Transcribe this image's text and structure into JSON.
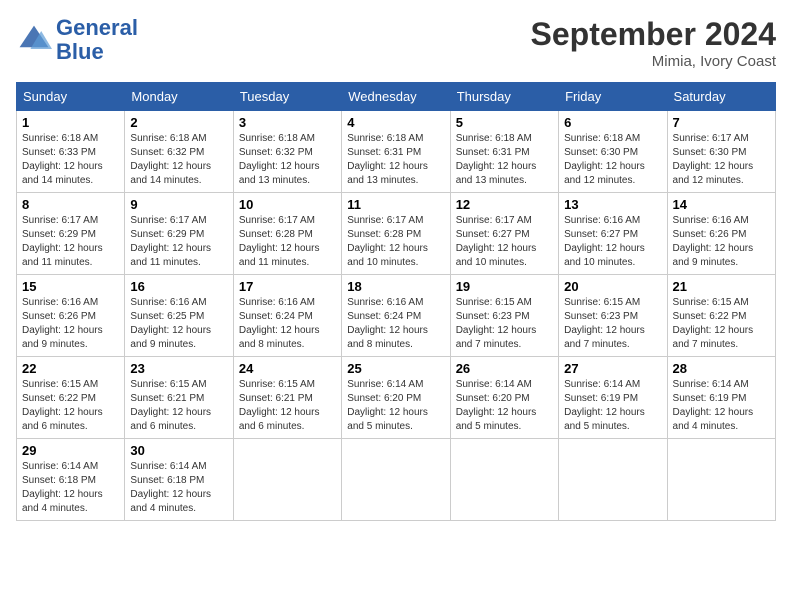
{
  "header": {
    "logo_line1": "General",
    "logo_line2": "Blue",
    "month_title": "September 2024",
    "location": "Mimia, Ivory Coast"
  },
  "days_of_week": [
    "Sunday",
    "Monday",
    "Tuesday",
    "Wednesday",
    "Thursday",
    "Friday",
    "Saturday"
  ],
  "weeks": [
    [
      {
        "num": "1",
        "sunrise": "6:18 AM",
        "sunset": "6:33 PM",
        "daylight": "12 hours and 14 minutes."
      },
      {
        "num": "2",
        "sunrise": "6:18 AM",
        "sunset": "6:32 PM",
        "daylight": "12 hours and 14 minutes."
      },
      {
        "num": "3",
        "sunrise": "6:18 AM",
        "sunset": "6:32 PM",
        "daylight": "12 hours and 13 minutes."
      },
      {
        "num": "4",
        "sunrise": "6:18 AM",
        "sunset": "6:31 PM",
        "daylight": "12 hours and 13 minutes."
      },
      {
        "num": "5",
        "sunrise": "6:18 AM",
        "sunset": "6:31 PM",
        "daylight": "12 hours and 13 minutes."
      },
      {
        "num": "6",
        "sunrise": "6:18 AM",
        "sunset": "6:30 PM",
        "daylight": "12 hours and 12 minutes."
      },
      {
        "num": "7",
        "sunrise": "6:17 AM",
        "sunset": "6:30 PM",
        "daylight": "12 hours and 12 minutes."
      }
    ],
    [
      {
        "num": "8",
        "sunrise": "6:17 AM",
        "sunset": "6:29 PM",
        "daylight": "12 hours and 11 minutes."
      },
      {
        "num": "9",
        "sunrise": "6:17 AM",
        "sunset": "6:29 PM",
        "daylight": "12 hours and 11 minutes."
      },
      {
        "num": "10",
        "sunrise": "6:17 AM",
        "sunset": "6:28 PM",
        "daylight": "12 hours and 11 minutes."
      },
      {
        "num": "11",
        "sunrise": "6:17 AM",
        "sunset": "6:28 PM",
        "daylight": "12 hours and 10 minutes."
      },
      {
        "num": "12",
        "sunrise": "6:17 AM",
        "sunset": "6:27 PM",
        "daylight": "12 hours and 10 minutes."
      },
      {
        "num": "13",
        "sunrise": "6:16 AM",
        "sunset": "6:27 PM",
        "daylight": "12 hours and 10 minutes."
      },
      {
        "num": "14",
        "sunrise": "6:16 AM",
        "sunset": "6:26 PM",
        "daylight": "12 hours and 9 minutes."
      }
    ],
    [
      {
        "num": "15",
        "sunrise": "6:16 AM",
        "sunset": "6:26 PM",
        "daylight": "12 hours and 9 minutes."
      },
      {
        "num": "16",
        "sunrise": "6:16 AM",
        "sunset": "6:25 PM",
        "daylight": "12 hours and 9 minutes."
      },
      {
        "num": "17",
        "sunrise": "6:16 AM",
        "sunset": "6:24 PM",
        "daylight": "12 hours and 8 minutes."
      },
      {
        "num": "18",
        "sunrise": "6:16 AM",
        "sunset": "6:24 PM",
        "daylight": "12 hours and 8 minutes."
      },
      {
        "num": "19",
        "sunrise": "6:15 AM",
        "sunset": "6:23 PM",
        "daylight": "12 hours and 7 minutes."
      },
      {
        "num": "20",
        "sunrise": "6:15 AM",
        "sunset": "6:23 PM",
        "daylight": "12 hours and 7 minutes."
      },
      {
        "num": "21",
        "sunrise": "6:15 AM",
        "sunset": "6:22 PM",
        "daylight": "12 hours and 7 minutes."
      }
    ],
    [
      {
        "num": "22",
        "sunrise": "6:15 AM",
        "sunset": "6:22 PM",
        "daylight": "12 hours and 6 minutes."
      },
      {
        "num": "23",
        "sunrise": "6:15 AM",
        "sunset": "6:21 PM",
        "daylight": "12 hours and 6 minutes."
      },
      {
        "num": "24",
        "sunrise": "6:15 AM",
        "sunset": "6:21 PM",
        "daylight": "12 hours and 6 minutes."
      },
      {
        "num": "25",
        "sunrise": "6:14 AM",
        "sunset": "6:20 PM",
        "daylight": "12 hours and 5 minutes."
      },
      {
        "num": "26",
        "sunrise": "6:14 AM",
        "sunset": "6:20 PM",
        "daylight": "12 hours and 5 minutes."
      },
      {
        "num": "27",
        "sunrise": "6:14 AM",
        "sunset": "6:19 PM",
        "daylight": "12 hours and 5 minutes."
      },
      {
        "num": "28",
        "sunrise": "6:14 AM",
        "sunset": "6:19 PM",
        "daylight": "12 hours and 4 minutes."
      }
    ],
    [
      {
        "num": "29",
        "sunrise": "6:14 AM",
        "sunset": "6:18 PM",
        "daylight": "12 hours and 4 minutes."
      },
      {
        "num": "30",
        "sunrise": "6:14 AM",
        "sunset": "6:18 PM",
        "daylight": "12 hours and 4 minutes."
      },
      null,
      null,
      null,
      null,
      null
    ]
  ],
  "labels": {
    "sunrise": "Sunrise:",
    "sunset": "Sunset:",
    "daylight": "Daylight:"
  }
}
